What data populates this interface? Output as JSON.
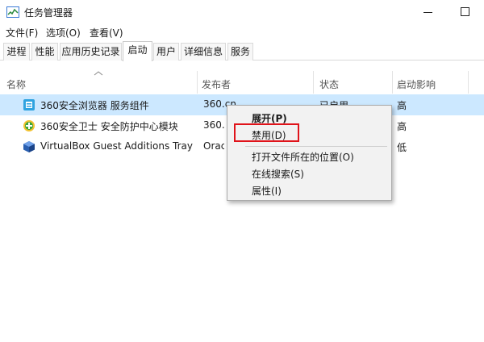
{
  "window": {
    "title": "任务管理器"
  },
  "menu": [
    "文件(F)",
    "选项(O)",
    "查看(V)"
  ],
  "tabs": [
    "进程",
    "性能",
    "应用历史记录",
    "启动",
    "用户",
    "详细信息",
    "服务"
  ],
  "active_tab": "启动",
  "columns": {
    "name": "名称",
    "publisher": "发布者",
    "status": "状态",
    "impact": "启动影响"
  },
  "rows": [
    {
      "name": "360安全浏览器 服务组件",
      "publisher": "360.cn",
      "status": "已启用",
      "impact": "高",
      "icon": "browser-360-icon"
    },
    {
      "name": "360安全卫士 安全防护中心模块",
      "publisher": "360.c",
      "status": "",
      "impact": "高",
      "icon": "shield-360-icon"
    },
    {
      "name": "VirtualBox Guest Additions Tray ...",
      "publisher": "Orac",
      "status": "",
      "impact": "低",
      "icon": "virtualbox-icon"
    }
  ],
  "context_menu": {
    "expand": "展开(P)",
    "disable": "禁用(D)",
    "open_location": "打开文件所在的位置(O)",
    "search_online": "在线搜索(S)",
    "properties": "属性(I)"
  },
  "colors": {
    "selection": "#cce8ff",
    "highlight_border": "#e0131a",
    "menu_bg": "#f2f2f2"
  }
}
